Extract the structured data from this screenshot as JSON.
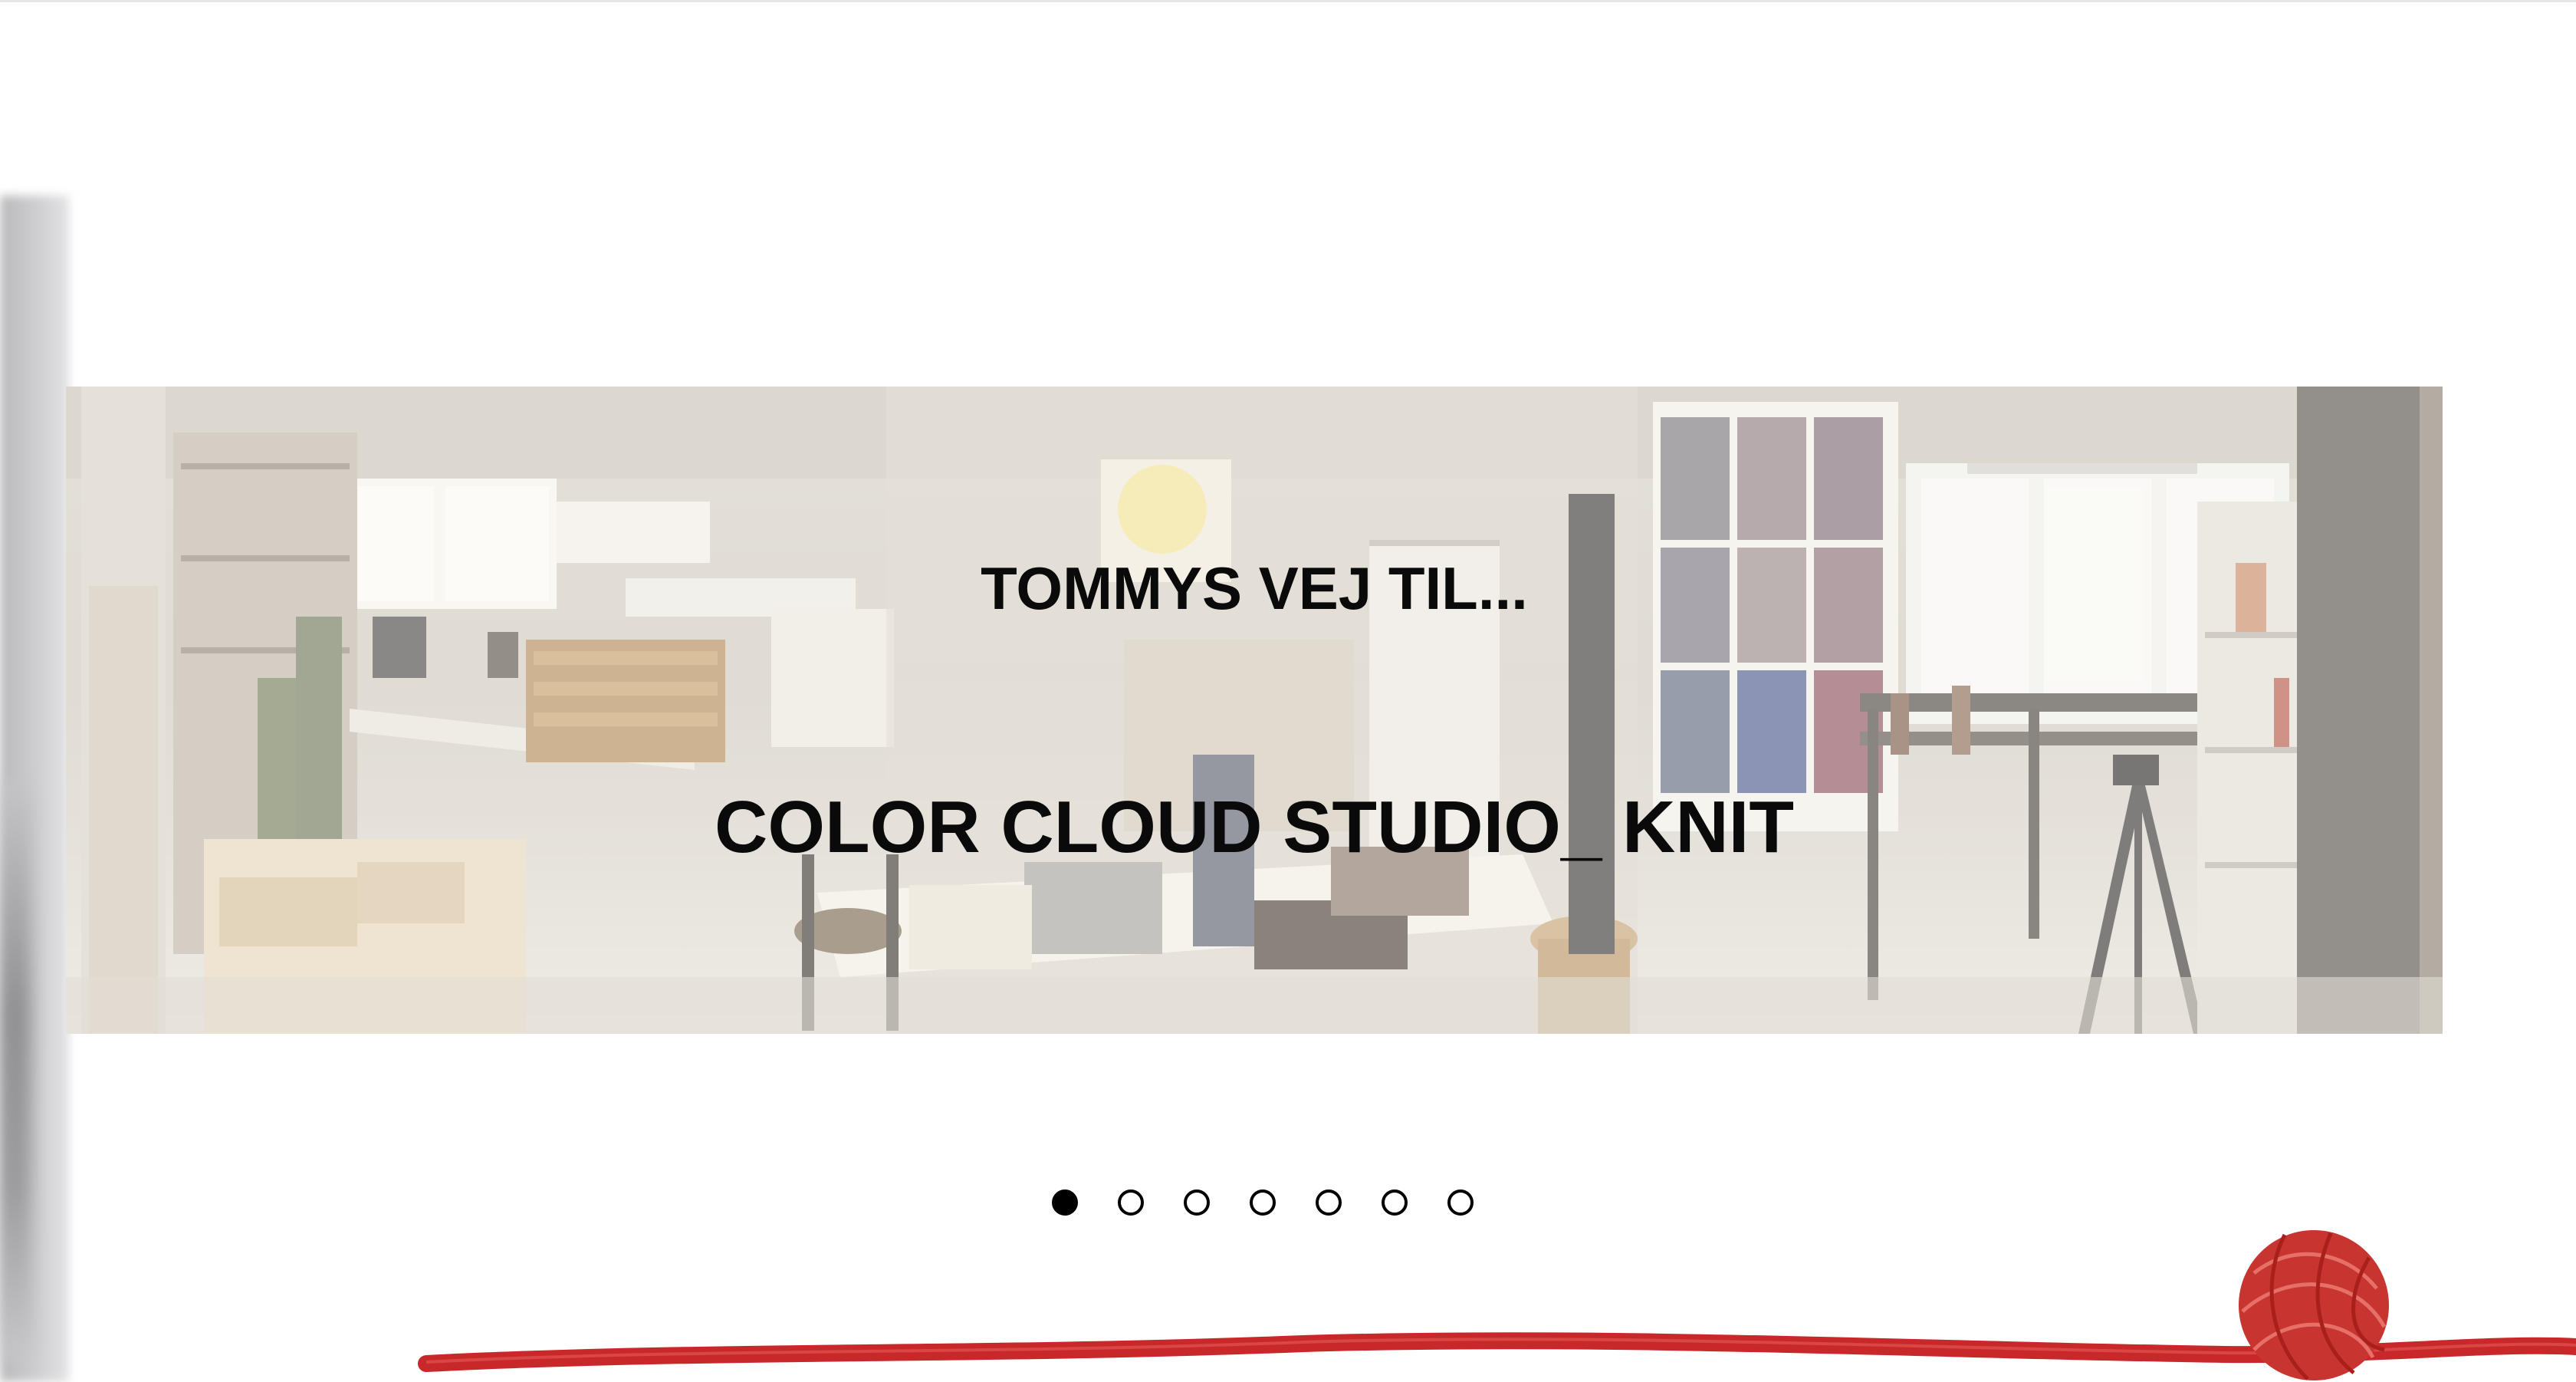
{
  "hero": {
    "subtitle": "TOMMYS VEJ TIL...",
    "title": "COLOR CLOUD STUDIO_ KNIT"
  },
  "carousel": {
    "slide_count": 7,
    "active_index": 0
  },
  "colors": {
    "yarn": "#c8282a",
    "dot": "#000000"
  }
}
